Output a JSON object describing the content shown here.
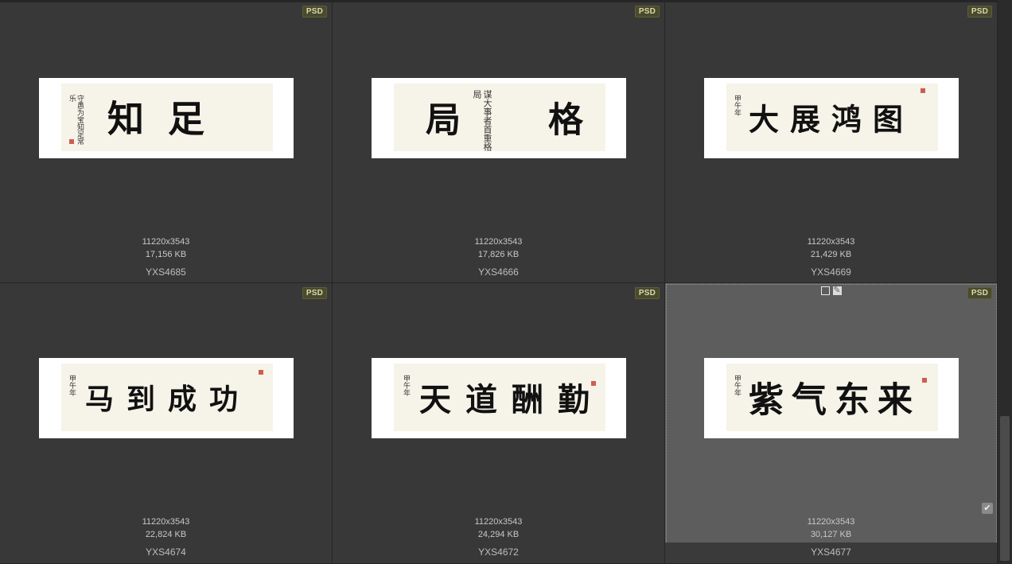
{
  "thumbnails": [
    {
      "format": "PSD",
      "dimensions": "11220x3543",
      "size": "17,156 KB",
      "name": "YXS4685",
      "title_text": "知足",
      "sign_text": "守愚为宝知足常乐"
    },
    {
      "format": "PSD",
      "dimensions": "11220x3543",
      "size": "17,826 KB",
      "name": "YXS4666",
      "title_text": "局格",
      "sign_text": "谋大事者首重格局"
    },
    {
      "format": "PSD",
      "dimensions": "11220x3543",
      "size": "21,429 KB",
      "name": "YXS4669",
      "title_text": "大展鸿图",
      "sign_text": "甲午年"
    },
    {
      "format": "PSD",
      "dimensions": "11220x3543",
      "size": "22,824 KB",
      "name": "YXS4674",
      "title_text": "马到成功",
      "sign_text": "甲午年"
    },
    {
      "format": "PSD",
      "dimensions": "11220x3543",
      "size": "24,294 KB",
      "name": "YXS4672",
      "title_text": "天道酬勤",
      "sign_text": "甲午年"
    },
    {
      "format": "PSD",
      "dimensions": "11220x3543",
      "size": "30,127 KB",
      "name": "YXS4677",
      "title_text": "紫气东来",
      "sign_text": "甲午年"
    }
  ],
  "selected_tools": {
    "checkbox_icon": "square-icon",
    "edit_icon": "pencil-icon",
    "edit_glyph": "✎",
    "check_glyph": "✔"
  },
  "colors": {
    "cell_bg": "#383838",
    "selected_bg": "#5d5d5d",
    "badge_bg": "#4a4a2e",
    "paper": "#f6f3e8"
  }
}
